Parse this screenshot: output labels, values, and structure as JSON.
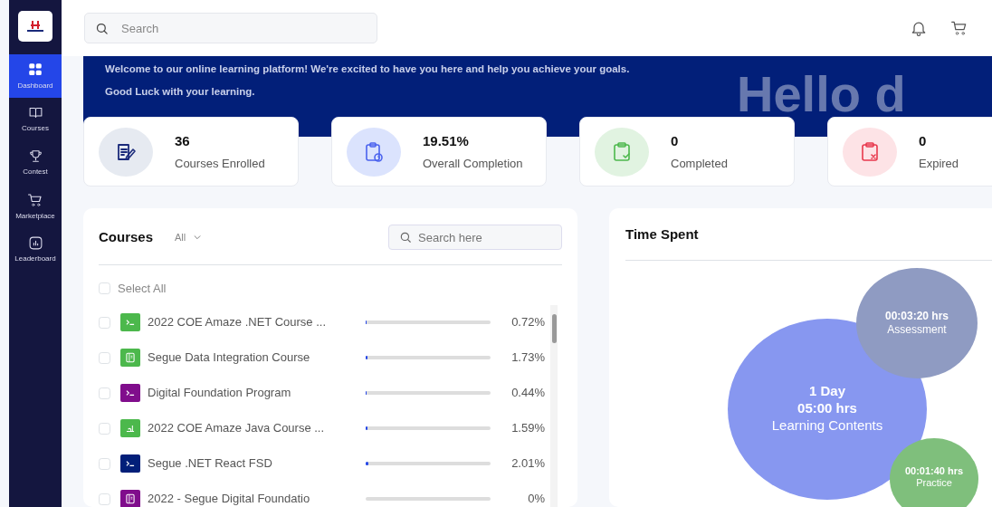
{
  "sidebar": {
    "items": [
      {
        "label": "Dashboard",
        "kind": "grid",
        "selected": true
      },
      {
        "label": "Courses",
        "kind": "book",
        "selected": false
      },
      {
        "label": "Contest",
        "kind": "trophy",
        "selected": false
      },
      {
        "label": "Marketplace",
        "kind": "cart",
        "selected": false
      },
      {
        "label": "Leaderboard",
        "kind": "chart",
        "selected": false
      }
    ]
  },
  "header": {
    "search": {
      "placeholder": "Search"
    }
  },
  "banner": {
    "lines": [
      "Welcome to our online learning platform! We're excited to have you here and help you achieve your goals.",
      "Good Luck with your learning."
    ],
    "big_text": "Hello d"
  },
  "stats": [
    {
      "value": "36",
      "label": "Courses Enrolled",
      "kind": "edit",
      "color": "#e6eaf1"
    },
    {
      "value": "19.51%",
      "label": "Overall Completion",
      "kind": "clock",
      "color": "#dbe3fd"
    },
    {
      "value": "0",
      "label": "Completed",
      "kind": "check",
      "color": "#e1f3e1"
    },
    {
      "value": "0",
      "label": "Expired",
      "kind": "cross",
      "color": "#fde3e6"
    }
  ],
  "courses": {
    "title": "Courses",
    "filter": "All",
    "search": {
      "placeholder": "Search here"
    },
    "select_all": {
      "label": "Select All",
      "checked": false
    },
    "rows": [
      {
        "name": "2022 COE Amaze .NET Course ...",
        "kind": "terminal",
        "color": "#4cb84c",
        "level": 0.0072,
        "percent": "0.72%",
        "checked": false
      },
      {
        "name": "Segue Data Integration Course",
        "kind": "book",
        "color": "#4cb84c",
        "level": 0.0173,
        "percent": "1.73%",
        "checked": false
      },
      {
        "name": "Digital Foundation Program",
        "kind": "terminal",
        "color": "#800d8c",
        "level": 0.0044,
        "percent": "0.44%",
        "checked": false
      },
      {
        "name": "2022 COE Amaze Java Course ...",
        "kind": "chart",
        "color": "#4cb84c",
        "level": 0.0159,
        "percent": "1.59%",
        "checked": false
      },
      {
        "name": "Segue .NET React FSD",
        "kind": "terminal",
        "color": "#021f79",
        "level": 0.0201,
        "percent": "2.01%",
        "checked": false
      },
      {
        "name": "2022 - Segue Digital Foundatio",
        "kind": "book",
        "color": "#800d8c",
        "level": 0,
        "percent": "0%",
        "checked": false
      }
    ]
  },
  "time_spent": {
    "title": "Time Spent",
    "bubbles": [
      {
        "time": "00:03:20 hrs",
        "label": "Assessment",
        "color": "#8f9bc2"
      },
      {
        "day": "1 Day",
        "time": "05:00 hrs",
        "label": "Learning Contents",
        "color": "#8797f0"
      },
      {
        "time": "00:01:40 hrs",
        "label": "Practice",
        "color": "#7fbf7c"
      }
    ]
  }
}
